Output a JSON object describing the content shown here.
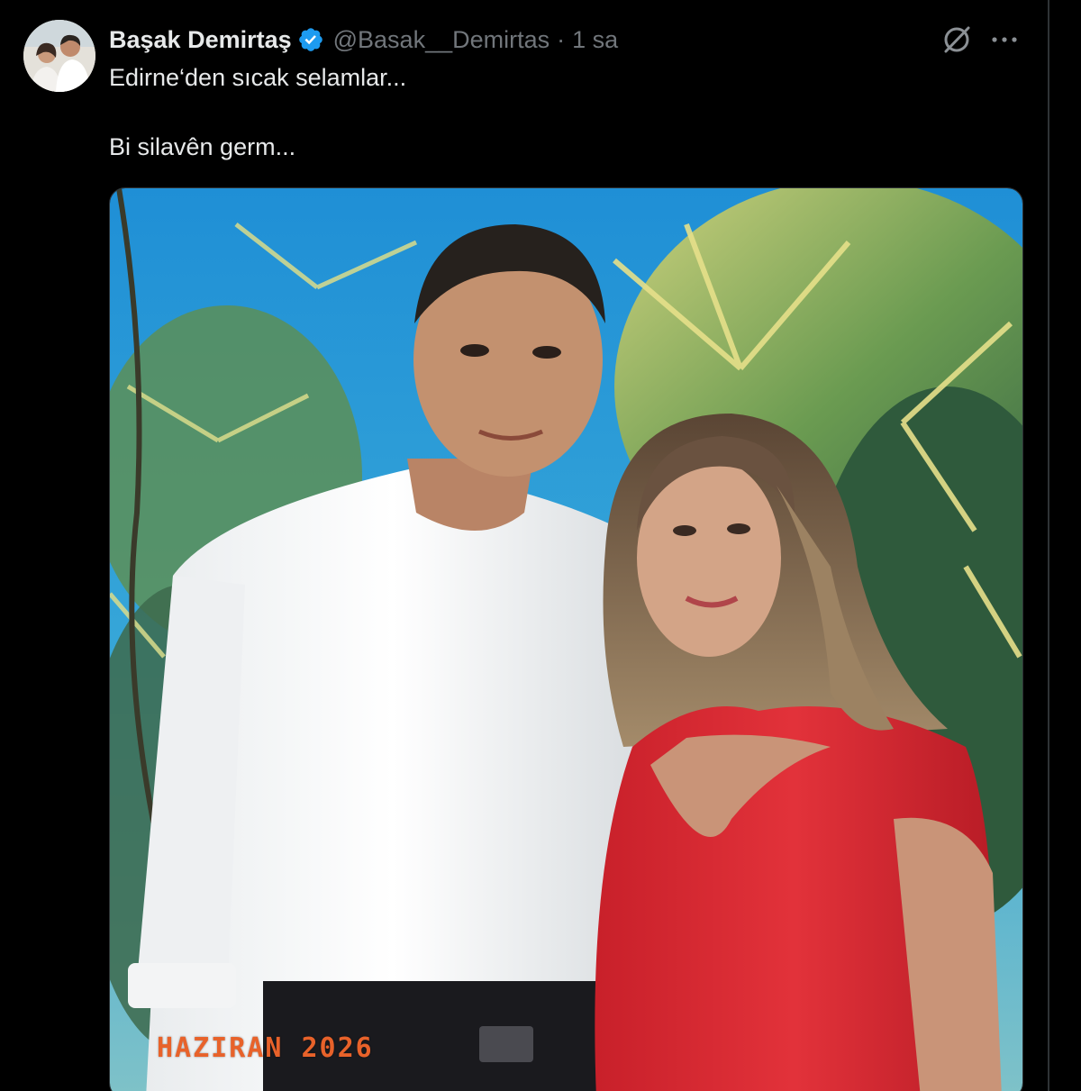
{
  "tweet": {
    "author": {
      "display_name": "Başak Demirtaş",
      "handle": "@Basak__Demirtas",
      "verified": true,
      "avatar_icon": "profile-photo"
    },
    "separator": "·",
    "time": "1 sa",
    "text_lines": [
      "Edirne‘den sıcak selamlar...",
      "Bi silavên germ..."
    ],
    "media": {
      "stamp_text": "HAZIRAN 2026"
    },
    "actions": {
      "grok_icon": "grok-icon",
      "more_icon": "more-icon"
    }
  },
  "colors": {
    "background": "#000000",
    "primary_text": "#e7e9ea",
    "secondary_text": "#71767b",
    "verified_blue": "#1d9bf0",
    "stamp_orange": "#e8622a"
  }
}
